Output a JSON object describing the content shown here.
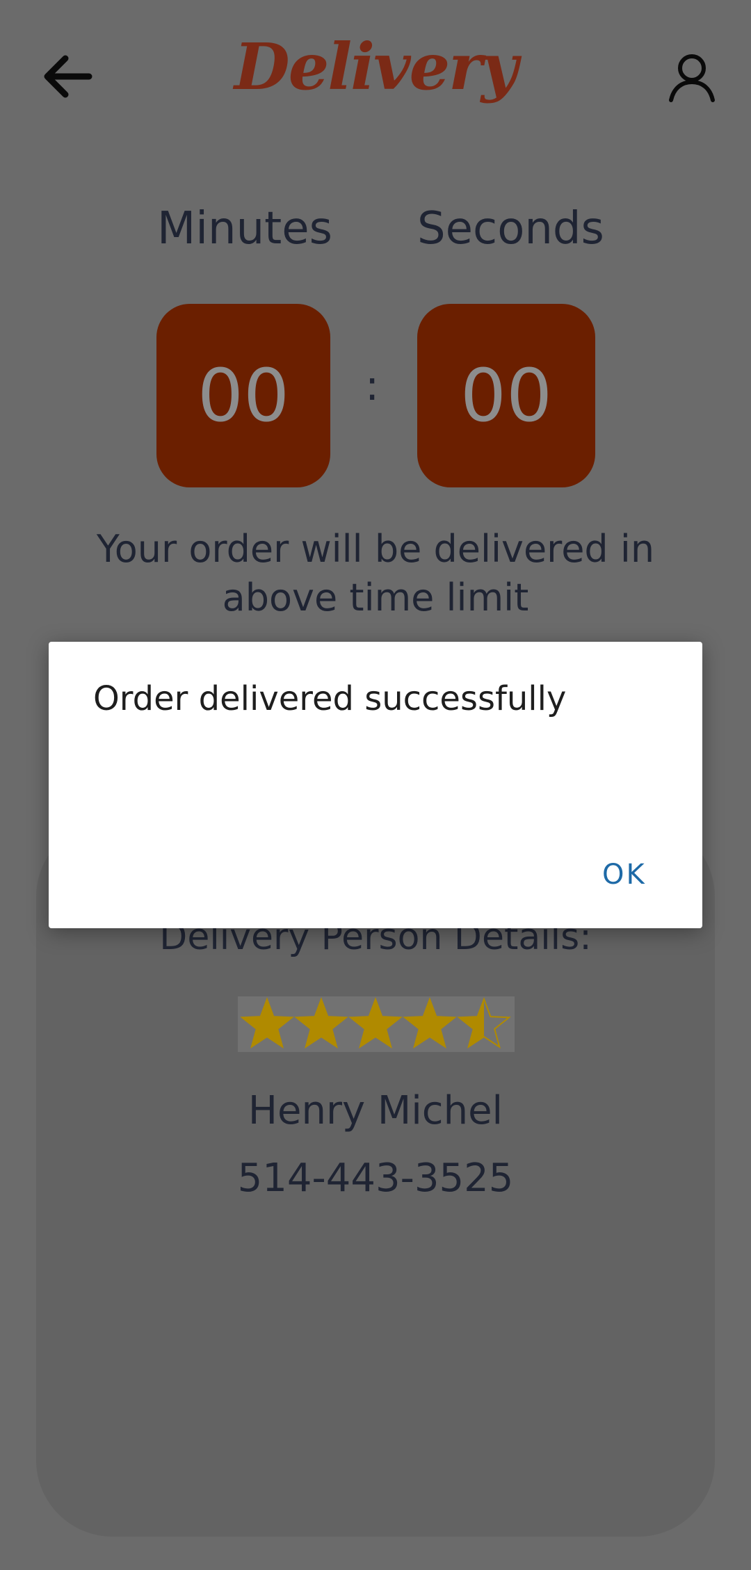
{
  "header": {
    "title": "Delivery",
    "back_icon": "arrow-left-icon",
    "profile_icon": "user-icon"
  },
  "timer": {
    "minutes_label": "Minutes",
    "seconds_label": "Seconds",
    "minutes_value": "00",
    "seconds_value": "00",
    "separator": ":"
  },
  "message": {
    "line1": "Your order will be delivered in",
    "line2": "above time limit"
  },
  "delivery_person": {
    "title": "Delivery Person Details:",
    "rating": 4.5,
    "rating_max": 5,
    "name": "Henry Michel",
    "phone": "514-443-3525"
  },
  "dialog": {
    "message": "Order delivered successfully",
    "ok_label": "OK"
  },
  "colors": {
    "brand": "#7b2a16",
    "timer_box": "#6b1f00",
    "star": "#b08a00",
    "dialog_button": "#1e6aa7"
  }
}
